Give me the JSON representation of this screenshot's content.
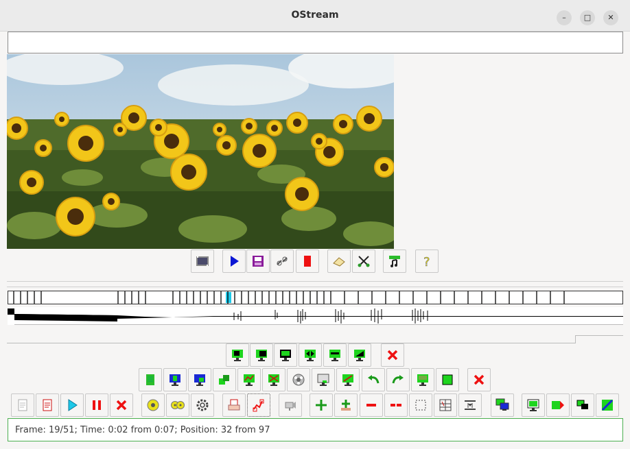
{
  "window": {
    "title": "OStream"
  },
  "status": {
    "text": "Frame: 19/51; Time: 0:02 from 0:07; Position: 32 from 97"
  },
  "frames": {
    "total": 51,
    "current": 19
  },
  "colors": {
    "accent": "#1ec8e8",
    "status_border": "#4caf50",
    "title_bar": "#ebebeb"
  },
  "toolbar_player": [
    "film-icon",
    "play-icon",
    "save-icon",
    "chain-icon",
    "stop-icon",
    "erase-icon",
    "cut-icon",
    "music-icon",
    "help-icon"
  ],
  "toolbar_row1": [
    "monitor-green-icon",
    "monitor-black-icon",
    "monitor-outline-icon",
    "monitor-arrows-icon",
    "monitor-split-icon",
    "monitor-gradient-icon",
    "close-icon"
  ],
  "toolbar_row2": [
    "page-icon",
    "monitor-blue-icon",
    "monitor-blue-down-icon",
    "shapes-icon",
    "monitor-chart-icon",
    "monitor-cross-icon",
    "film-reel-icon",
    "monitor-small-icon",
    "monitor-slash-icon",
    "undo-icon",
    "redo-icon",
    "monitor-rec-icon",
    "green-square-icon",
    "close-icon"
  ],
  "toolbar_row3": [
    "new-file-icon",
    "open-file-icon",
    "play-icon",
    "pause-icon",
    "close-icon",
    "disc-icon",
    "two-discs-icon",
    "gear-icon",
    "print-icon",
    "transform-icon",
    "camera-icon",
    "add-icon",
    "add-bar-icon",
    "remove-icon",
    "remove-dual-icon",
    "select-icon",
    "grid-icon",
    "split-icon",
    "monitor-copy-icon",
    "monitor-icon",
    "monitor-forward-icon",
    "monitor-swap-icon",
    "monitor-diagonal-icon"
  ]
}
